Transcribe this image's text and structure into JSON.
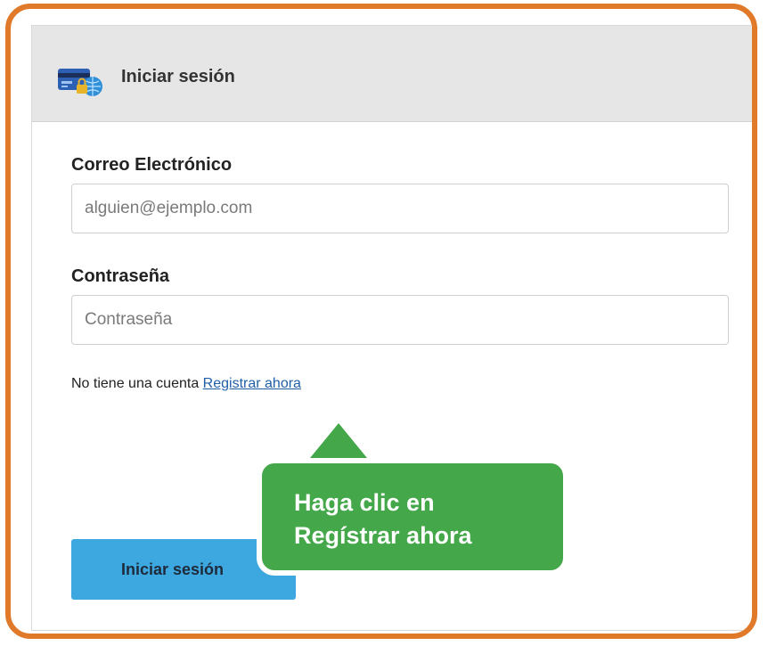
{
  "header": {
    "title": "Iniciar sesión",
    "icon": "credit-card-lock-globe-icon"
  },
  "form": {
    "email": {
      "label": "Correo Electrónico",
      "placeholder": "alguien@ejemplo.com",
      "value": ""
    },
    "password": {
      "label": "Contraseña",
      "placeholder": "Contraseña",
      "value": ""
    },
    "register_prompt": "No tiene una cuenta",
    "register_link": "Registrar ahora",
    "submit_label": "Iniciar sesión"
  },
  "callout": {
    "line1": "Haga clic en",
    "line2": "Regístrar ahora"
  },
  "colors": {
    "frame": "#e07a2a",
    "button": "#3da7e0",
    "callout": "#44a84a",
    "link": "#1f5fa8"
  }
}
